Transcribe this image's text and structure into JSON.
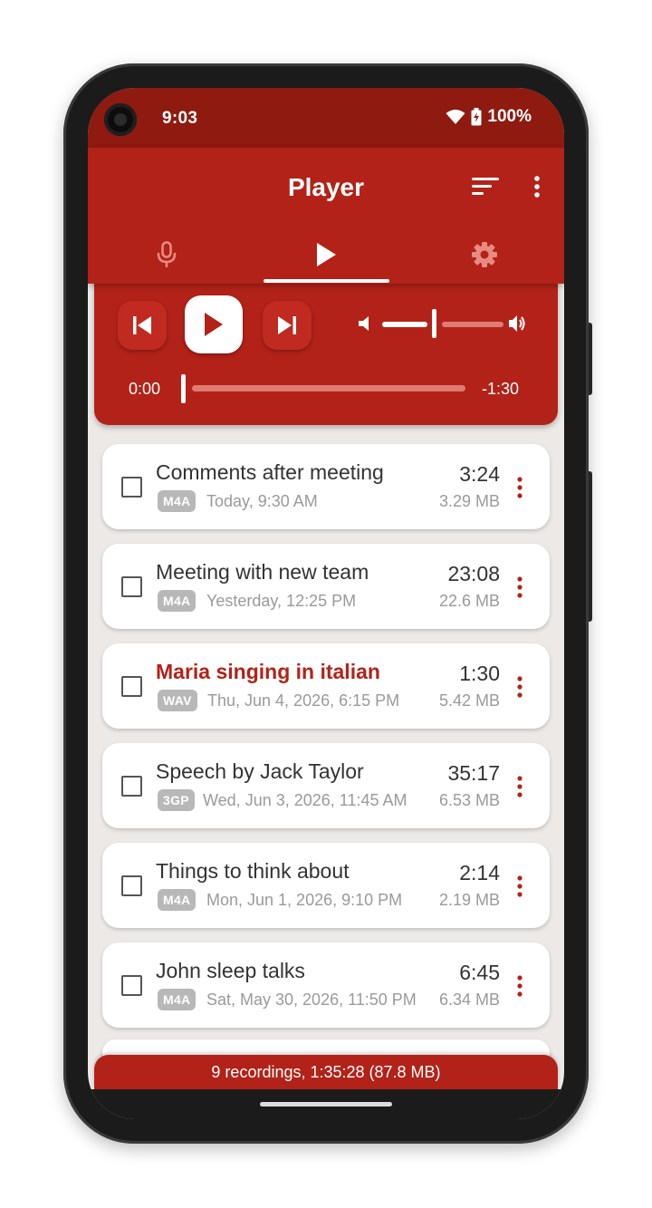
{
  "status_bar": {
    "time": "9:03",
    "battery": "100%"
  },
  "app_bar": {
    "title": "Player",
    "icons": [
      "sort-icon",
      "more-vert-icon"
    ],
    "tabs": [
      {
        "icon": "mic-icon",
        "selected": false
      },
      {
        "icon": "play-icon",
        "selected": true
      },
      {
        "icon": "gear-icon",
        "selected": false
      }
    ]
  },
  "player": {
    "elapsed": "0:00",
    "remaining": "-1:30",
    "volume_level": 0.45,
    "progress": 0.0
  },
  "recordings": [
    {
      "name": "Comments after meeting",
      "format": "M4A",
      "date": "Today, 9:30 AM",
      "duration": "3:24",
      "size": "3.29 MB",
      "active": false
    },
    {
      "name": "Meeting with new team",
      "format": "M4A",
      "date": "Yesterday, 12:25 PM",
      "duration": "23:08",
      "size": "22.6 MB",
      "active": false
    },
    {
      "name": "Maria singing in italian",
      "format": "WAV",
      "date": "Thu, Jun 4, 2026, 6:15 PM",
      "duration": "1:30",
      "size": "5.42 MB",
      "active": true
    },
    {
      "name": "Speech by Jack Taylor",
      "format": "3GP",
      "date": "Wed, Jun 3, 2026, 11:45 AM",
      "duration": "35:17",
      "size": "6.53 MB",
      "active": false
    },
    {
      "name": "Things to think about",
      "format": "M4A",
      "date": "Mon, Jun 1, 2026, 9:10 PM",
      "duration": "2:14",
      "size": "2.19 MB",
      "active": false
    },
    {
      "name": "John sleep talks",
      "format": "M4A",
      "date": "Sat, May 30, 2026, 11:50 PM",
      "duration": "6:45",
      "size": "6.34 MB",
      "active": false
    }
  ],
  "footer": {
    "summary": "9 recordings, 1:35:28 (87.8 MB)"
  },
  "colors": {
    "primary": "#B22218",
    "primary_dark": "#8E1A10",
    "background": "#ECE9E7"
  }
}
